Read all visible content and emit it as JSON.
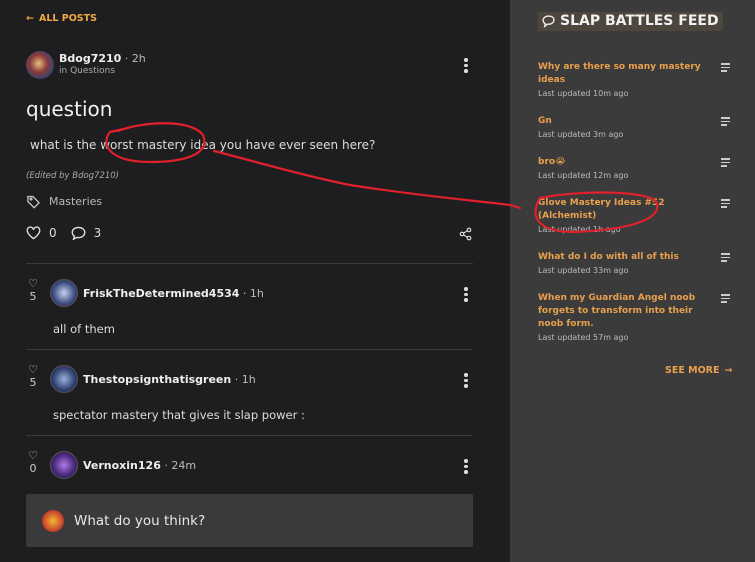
{
  "nav": {
    "back_label": "ALL POSTS"
  },
  "post": {
    "author": "Bdog7210",
    "time": "2h",
    "category": "in Questions",
    "title": "question",
    "body": "what is the worst mastery idea you have ever seen here?",
    "edited": "(Edited by Bdog7210)",
    "tag": "Masteries",
    "likes": "0",
    "comments": "3"
  },
  "comments": [
    {
      "likes": "5",
      "author": "FriskTheDetermined4534",
      "time": "1h",
      "text": "all of them"
    },
    {
      "likes": "5",
      "author": "Thestopsignthatisgreen",
      "time": "1h",
      "text": "spectator mastery that gives it slap power :"
    },
    {
      "likes": "0",
      "author": "Vernoxin126",
      "time": "24m",
      "text": ""
    }
  ],
  "reply": {
    "placeholder": "What do you think?"
  },
  "feed": {
    "title": "SLAP BATTLES FEED",
    "see_more": "SEE MORE",
    "items": [
      {
        "title": "Why are there so many mastery ideas",
        "updated": "Last updated 10m ago"
      },
      {
        "title": "Gn",
        "updated": "Last updated 3m ago"
      },
      {
        "title": "bro😭",
        "updated": "Last updated 12m ago"
      },
      {
        "title": "Glove Mastery Ideas #52 (Alchemist)",
        "updated": "Last updated 1h ago"
      },
      {
        "title": "What do I do with all of this",
        "updated": "Last updated 33m ago"
      },
      {
        "title": "When my Guardian Angel noob forgets to transform into their noob form.",
        "updated": "Last updated 57m ago"
      }
    ]
  },
  "colors": {
    "accent": "#e9a04d",
    "annotation": "#e0202a"
  }
}
